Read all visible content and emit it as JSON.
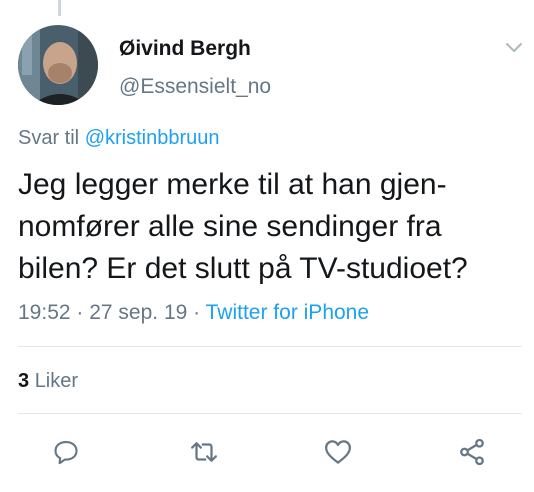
{
  "tweet": {
    "author": {
      "display_name": "Øivind Bergh",
      "handle": "@Essensielt_no",
      "avatar_icon": "user-avatar-photo"
    },
    "reply_prefix": "Svar til",
    "reply_mention": "@kristinbbruun",
    "text": "Jeg legger merke til at han gjen-nomfører alle sine sendinger fra bilen? Er det slutt på TV-studioet?",
    "time": "19:52",
    "date_sep": " · ",
    "date": "27 sep. 19",
    "source_sep": " · ",
    "source": "Twitter for iPhone",
    "likes_count": "3",
    "likes_label": "Liker"
  },
  "actions": [
    {
      "icon": "reply-icon"
    },
    {
      "icon": "retweet-icon"
    },
    {
      "icon": "like-icon"
    },
    {
      "icon": "share-icon"
    }
  ],
  "colors": {
    "link": "#1da1f2",
    "secondary_text": "#657786",
    "primary_text": "#14171a",
    "divider": "#e1e8ed"
  }
}
